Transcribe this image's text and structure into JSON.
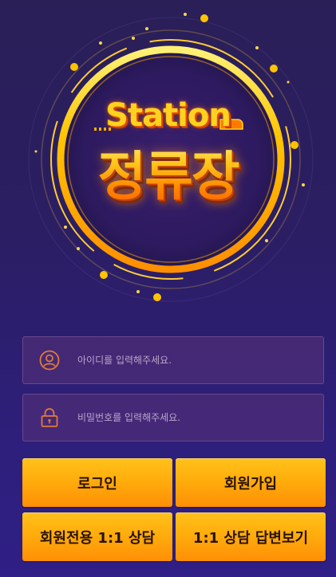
{
  "logo": {
    "station_text": "Station",
    "title_text": "정류장"
  },
  "login_form": {
    "id_placeholder": "아이디를 입력해주세요.",
    "password_placeholder": "비밀번호를 입력해주세요.",
    "id_icon": "user-circle-icon",
    "password_icon": "lock-icon"
  },
  "buttons": {
    "login": "로그인",
    "signup": "회원가입",
    "member_consult": "회원전용 1:1 상담",
    "consult_answers": "1:1 상담 답변보기"
  },
  "colors": {
    "background_top": "#2a1f57",
    "background_bottom": "#2f1f86",
    "button_gold": "#ffad0c",
    "icon_orange": "#e07a3c"
  }
}
